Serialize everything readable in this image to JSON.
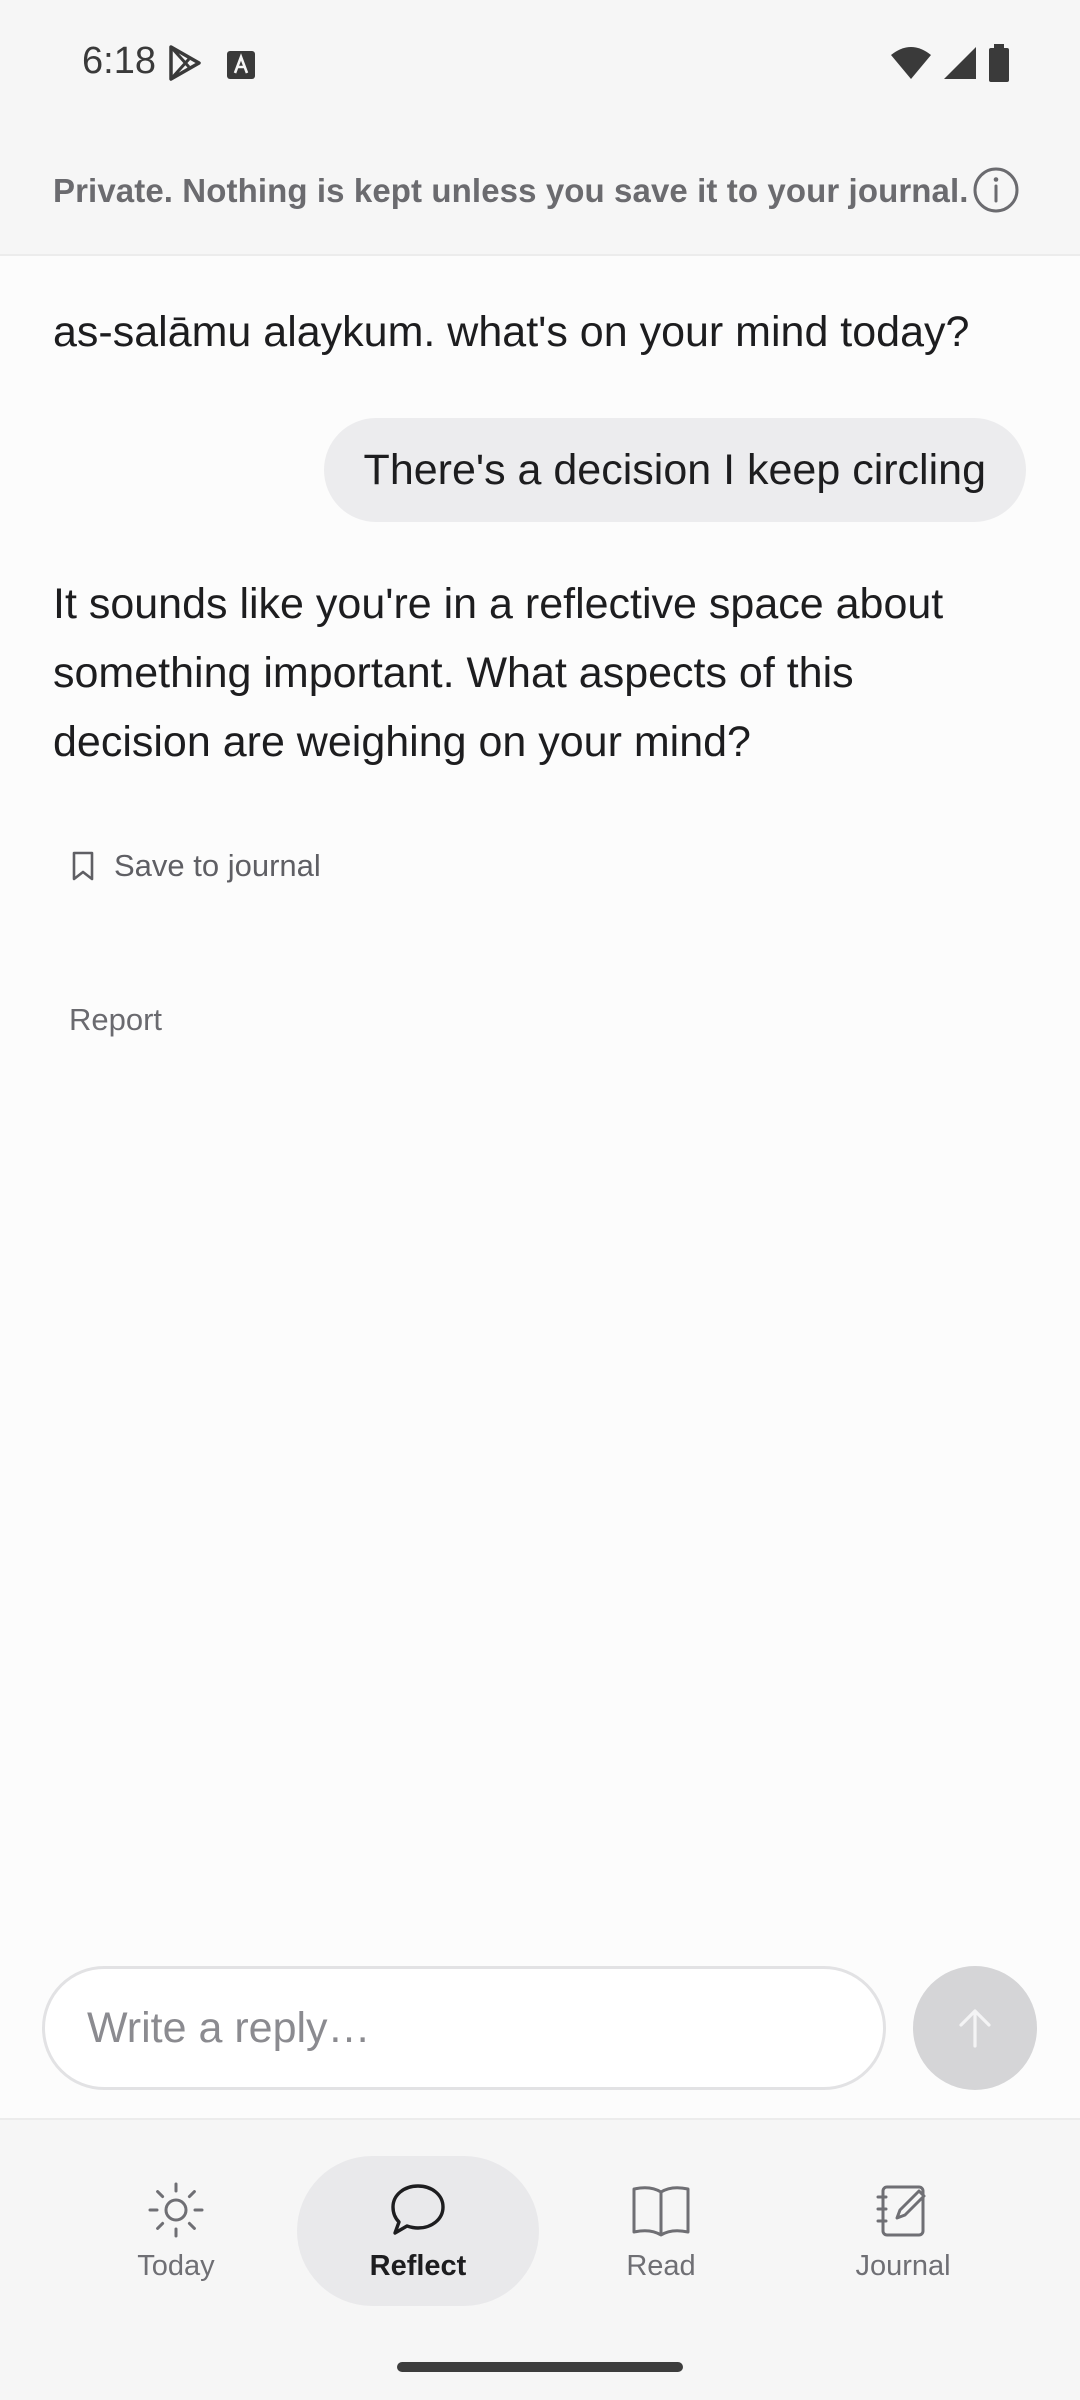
{
  "status_bar": {
    "time": "6:18"
  },
  "privacy_banner": {
    "text": "Private. Nothing is kept unless you save it to your journal."
  },
  "chat": {
    "greeting": "as-salāmu alaykum. what's on your mind today?",
    "user_message": "There's a decision I keep circling",
    "assistant_message": "It sounds like you're in a reflective space about something important. What aspects of this decision are weighing on your mind?",
    "save_label": "Save to journal",
    "report_label": "Report"
  },
  "composer": {
    "placeholder": "Write a reply…"
  },
  "nav": {
    "items": [
      {
        "label": "Today",
        "icon": "sun-icon"
      },
      {
        "label": "Reflect",
        "icon": "chat-bubble-icon"
      },
      {
        "label": "Read",
        "icon": "book-icon"
      },
      {
        "label": "Journal",
        "icon": "notebook-pencil-icon"
      }
    ],
    "active": "Reflect"
  },
  "colors": {
    "background": "#fcfcfc",
    "banner": "#f6f6f6",
    "user_bubble": "#ececee",
    "send_button": "#d5d5d7",
    "active_nav": "#e9e9eb"
  }
}
